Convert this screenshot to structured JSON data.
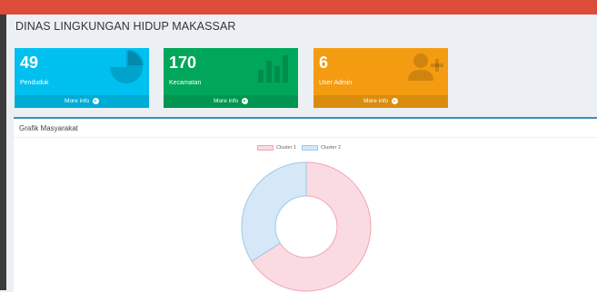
{
  "page": {
    "title": "DINAS LINGKUNGAN HIDUP MAKASSAR"
  },
  "stats": [
    {
      "value": "49",
      "label": "Penduduk",
      "more": "More info",
      "icon": "pie-chart-icon",
      "color": "#00c0ef"
    },
    {
      "value": "170",
      "label": "Kecamatan",
      "more": "More info",
      "icon": "bar-chart-icon",
      "color": "#00a65a"
    },
    {
      "value": "6",
      "label": "User Admin",
      "more": "More info",
      "icon": "user-add-icon",
      "color": "#f39c12"
    }
  ],
  "chart_panel": {
    "title": "Grafik Masyarakat"
  },
  "chart_data": {
    "type": "pie",
    "style": "doughnut",
    "categories": [
      "Cluster 1",
      "Cluster 2"
    ],
    "values": [
      66,
      34
    ],
    "colors": {
      "Cluster 1": "#fadbe1",
      "Cluster 2": "#d6e8f7"
    },
    "border_colors": {
      "Cluster 1": "#f5a3b3",
      "Cluster 2": "#9cc8ec"
    },
    "legend_position": "top"
  }
}
